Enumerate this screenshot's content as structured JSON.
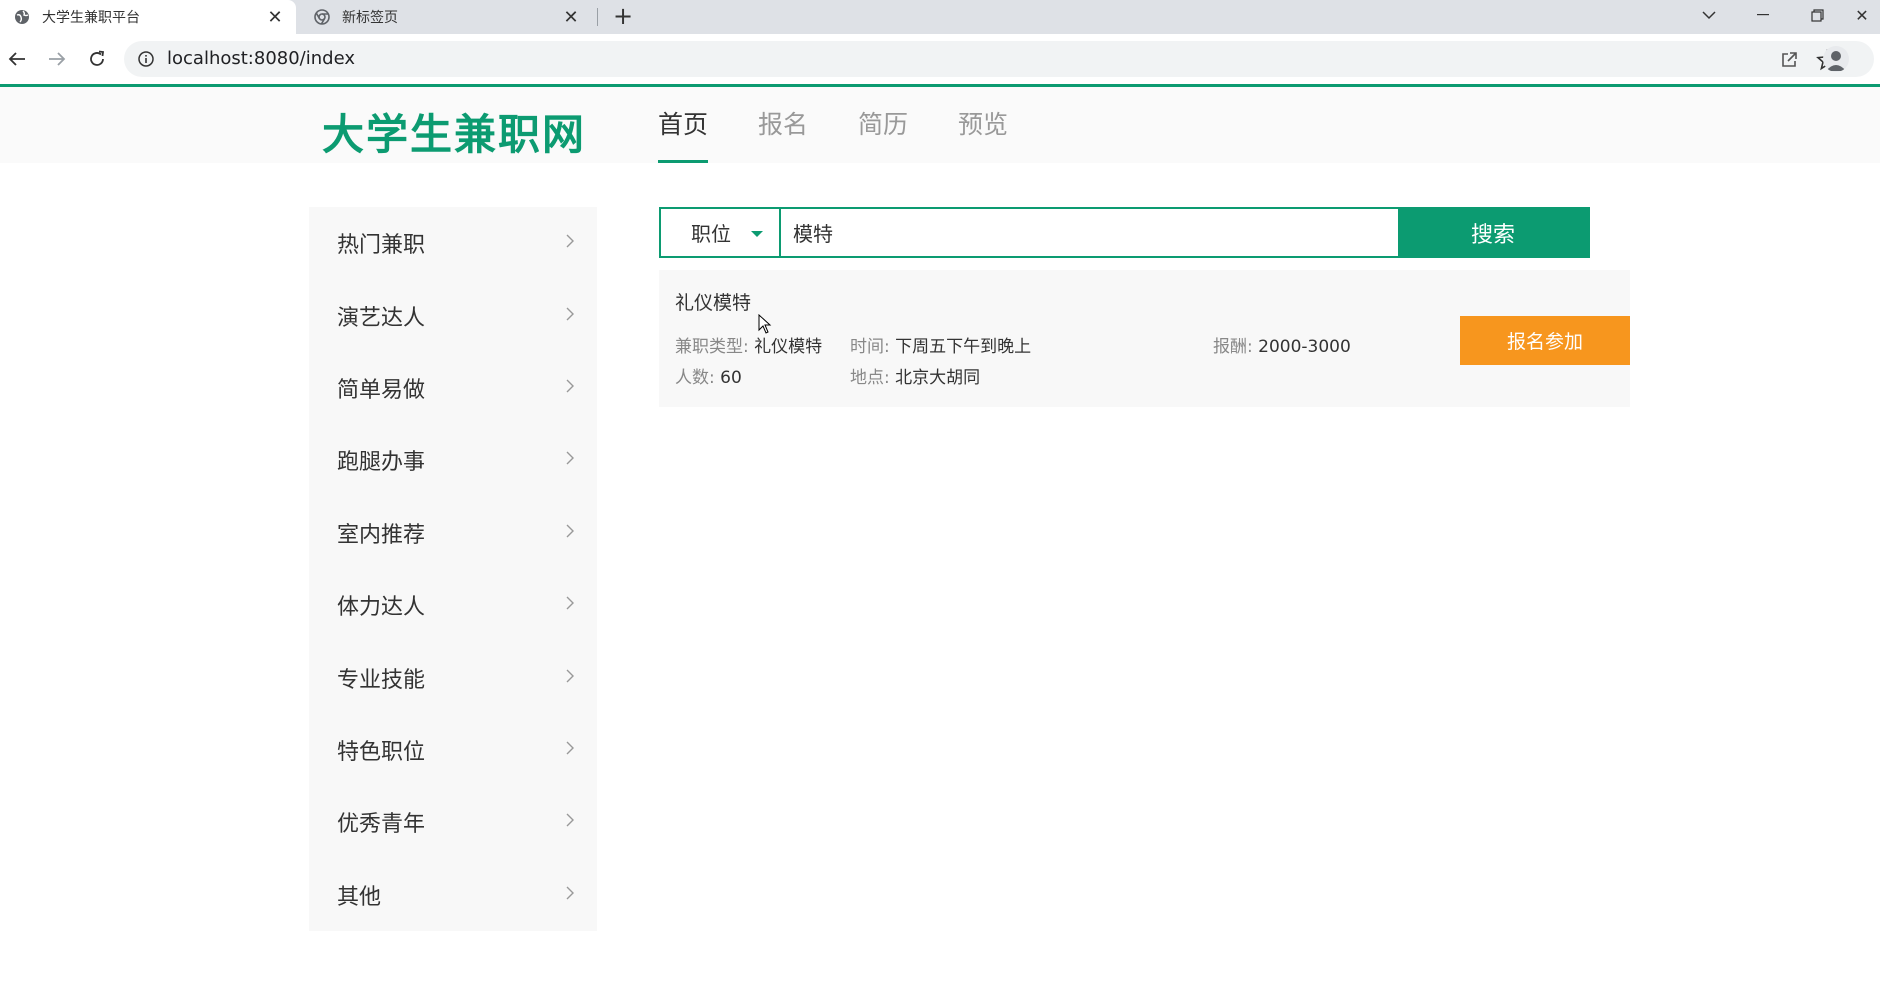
{
  "browser": {
    "tabs": [
      {
        "title": "大学生兼职平台",
        "active": true
      },
      {
        "title": "新标签页",
        "active": false
      }
    ],
    "url": "localhost:8080/index"
  },
  "header": {
    "logo": "大学生兼职网",
    "nav": [
      {
        "label": "首页",
        "active": true
      },
      {
        "label": "报名",
        "active": false
      },
      {
        "label": "简历",
        "active": false
      },
      {
        "label": "预览",
        "active": false
      }
    ]
  },
  "sidebar": {
    "items": [
      {
        "label": "热门兼职"
      },
      {
        "label": "演艺达人"
      },
      {
        "label": "简单易做"
      },
      {
        "label": "跑腿办事"
      },
      {
        "label": "室内推荐"
      },
      {
        "label": "体力达人"
      },
      {
        "label": "专业技能"
      },
      {
        "label": "特色职位"
      },
      {
        "label": "优秀青年"
      },
      {
        "label": "其他"
      }
    ]
  },
  "search": {
    "select_value": "职位",
    "query": "模特",
    "button": "搜索"
  },
  "result": {
    "title": "礼仪模特",
    "type_label": "兼职类型:",
    "type_value": "礼仪模特",
    "time_label": "时间:",
    "time_value": "下周五下午到晚上",
    "pay_label": "报酬:",
    "pay_value": "2000-3000",
    "count_label": "人数:",
    "count_value": "60",
    "place_label": "地点:",
    "place_value": "北京大胡同",
    "apply_button": "报名参加"
  },
  "colors": {
    "brand_green": "#0c9b71",
    "apply_orange": "#f7961e"
  }
}
